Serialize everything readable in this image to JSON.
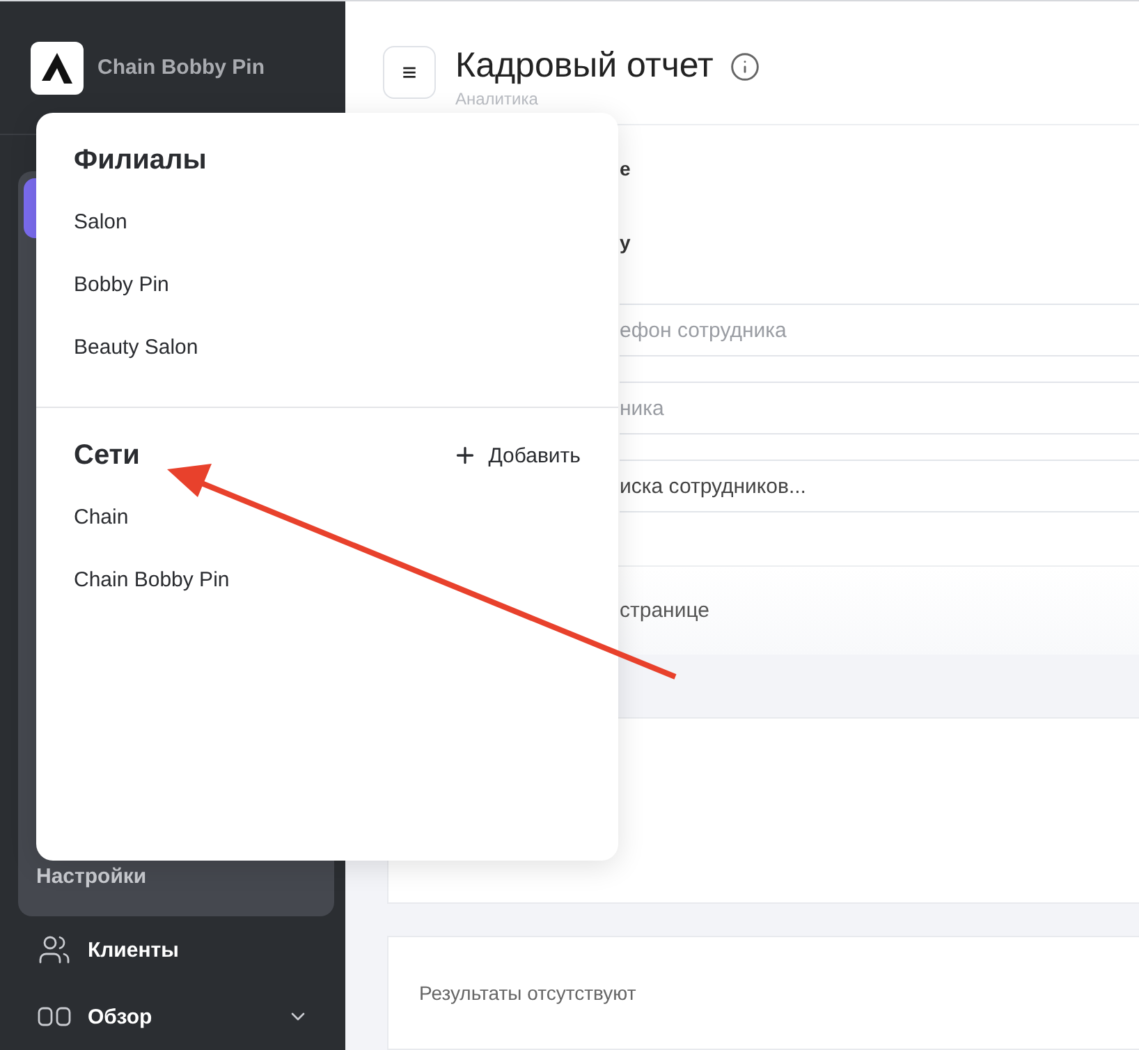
{
  "sidebar": {
    "brand": "Chain Bobby Pin",
    "group": {
      "label": "Настройки"
    },
    "items": [
      {
        "label": "Клиенты"
      },
      {
        "label": "Обзор"
      }
    ]
  },
  "header": {
    "menu_icon": "≡",
    "title": "Кадровый отчет",
    "subtitle": "Аналитика"
  },
  "content": {
    "labels": [
      "е",
      "у"
    ],
    "fields": [
      {
        "placeholder": "ефон сотрудника"
      },
      {
        "placeholder": "ника"
      },
      {
        "value": "иска сотрудников..."
      }
    ],
    "page_size_label": "странице",
    "empty_message": "Результаты отсутствуют"
  },
  "popover": {
    "branches": {
      "title": "Филиалы",
      "items": [
        "Salon",
        "Bobby Pin",
        "Beauty Salon"
      ]
    },
    "chains": {
      "title": "Сети",
      "add": "Добавить",
      "items": [
        "Chain",
        "Chain Bobby Pin"
      ]
    }
  }
}
